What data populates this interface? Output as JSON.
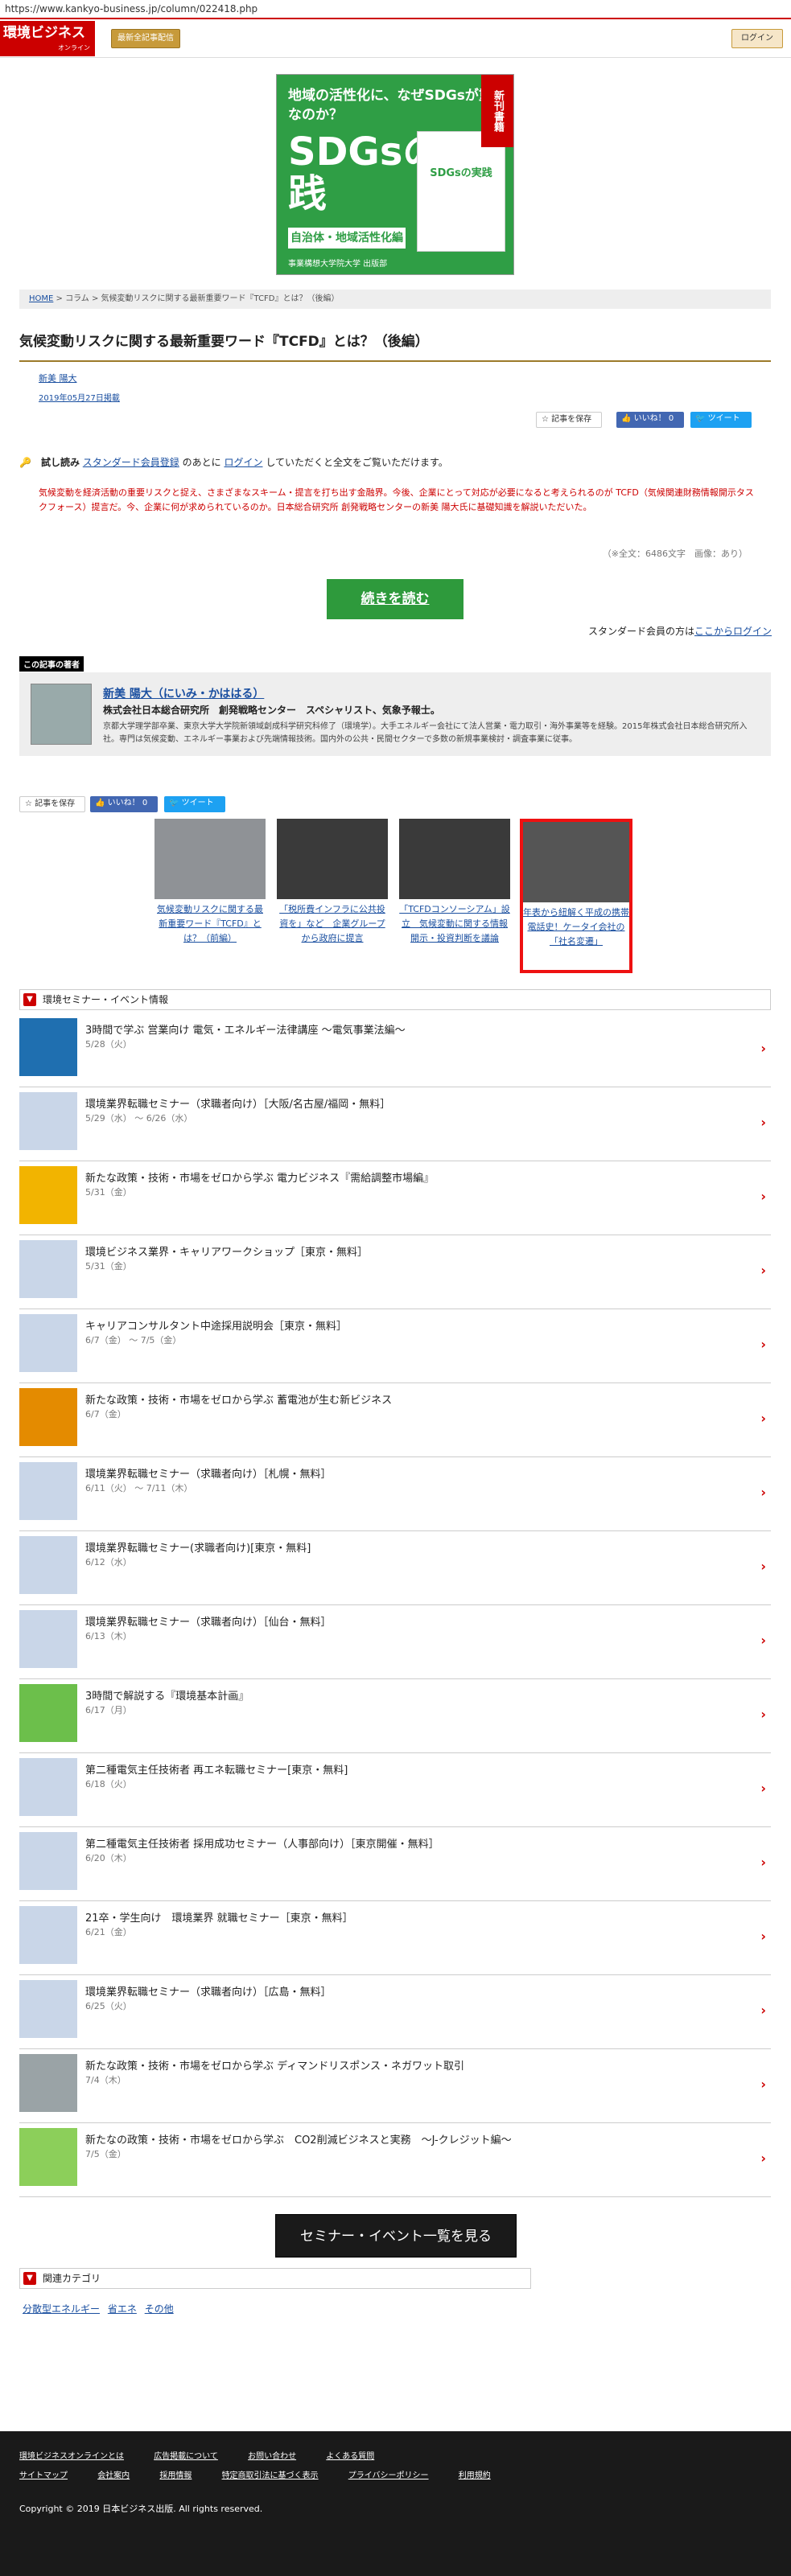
{
  "url": "https://www.kankyo-business.jp/column/022418.php",
  "header": {
    "logo_text": "環境ビジネス",
    "logo_sub": "オンライン",
    "news_button": "最新全記事配信",
    "login_button": "ログイン"
  },
  "banner": {
    "headline": "地域の活性化に、なぜSDGsが重要なのか？",
    "big_text": "SDGsの実践",
    "subtitle": "自治体・地域活性化編",
    "publisher": "事業構想大学院大学 出版部",
    "book_title": "SDGsの実践",
    "ribbon": "新刊書籍"
  },
  "breadcrumb": {
    "home": "HOME",
    "sep": " > ",
    "column": "コラム",
    "current": "気候変動リスクに関する最新重要ワード『TCFD』とは？（後編）"
  },
  "article": {
    "title": "気候変動リスクに関する最新重要ワード『TCFD』とは？（後編）",
    "author": "新美 陽大",
    "date": "2019年05月27日掲載",
    "save_label": "記事を保存",
    "like_label": "いいね！ 0",
    "tweet_label": "ツイート",
    "trial_label": "試し読み",
    "trial_link": "スタンダード会員登録",
    "trial_mid": "のあとに",
    "trial_login": "ログイン",
    "trial_tail": "していただくと全文をご覧いただけます。",
    "summary": "気候変動を経済活動の重要リスクと捉え、さまざまなスキーム・提言を打ち出す金融界。今後、企業にとって対応が必要になると考えられるのが TCFD（気候関連財務情報開示タスクフォース）提言だ。今、企業に何が求められているのか。日本総合研究所 創発戦略センターの新美 陽大氏に基礎知識を解説いただいた。",
    "count": "（※全文：6486文字　画像：あり）",
    "read_more": "続きを読む",
    "login_prefix": "スタンダード会員の方は",
    "login_link": "ここからログイン"
  },
  "author_box": {
    "section_label": "この記事の著者",
    "name": "新美 陽大（にいみ・かははる）",
    "org": "株式会社日本総合研究所　創発戦略センター　スペシャリスト、気象予報士。",
    "bio": "京都大学理学部卒業、東京大学大学院新領域創成科学研究科修了（環境学）。大手エネルギー会社にて法人営業・電力取引・海外事業等を経験。2015年株式会社日本総合研究所入社。専門は気候変動、エネルギー事業および先端情報技術。国内外の公共・民間セクターで多数の新規事業検討・調査事業に従事。"
  },
  "related": [
    {
      "caption": "気候変動リスクに関する最新重要ワード『TCFD』とは？（前編）"
    },
    {
      "caption": "「税所費インフラに公共投資を」など　企業グループから政府に提言"
    },
    {
      "caption": "「TCFDコンソーシアム」設立　気候変動に関する情報開示・投資判断を議論"
    },
    {
      "caption": "年表から紐解く平成の携帯電話史！ケータイ会社の「社名変遷」"
    }
  ],
  "events_section": {
    "title": "環境セミナー・イベント情報",
    "items": [
      {
        "title": "3時間で学ぶ 営業向け 電気・エネルギー法律講座 ～電気事業法編～",
        "date": "5/28（火）"
      },
      {
        "title": "環境業界転職セミナー（求職者向け）［大阪/名古屋/福岡・無料］",
        "date": "5/29（水） ～ 6/26（水）"
      },
      {
        "title": "新たな政策・技術・市場をゼロから学ぶ 電力ビジネス『需給調整市場編』",
        "date": "5/31（金）"
      },
      {
        "title": "環境ビジネス業界・キャリアワークショップ［東京・無料］",
        "date": "5/31（金）"
      },
      {
        "title": "キャリアコンサルタント中途採用説明会［東京・無料］",
        "date": "6/7（金） ～ 7/5（金）"
      },
      {
        "title": "新たな政策・技術・市場をゼロから学ぶ 蓄電池が生む新ビジネス",
        "date": "6/7（金）"
      },
      {
        "title": "環境業界転職セミナー（求職者向け）［札幌・無料］",
        "date": "6/11（火） ～ 7/11（木）"
      },
      {
        "title": "環境業界転職セミナー(求職者向け)[東京・無料]",
        "date": "6/12（水）"
      },
      {
        "title": "環境業界転職セミナー（求職者向け）［仙台・無料］",
        "date": "6/13（木）"
      },
      {
        "title": "3時間で解説する『環境基本計画』",
        "date": "6/17（月）"
      },
      {
        "title": "第二種電気主任技術者 再エネ転職セミナー[東京・無料]",
        "date": "6/18（火）"
      },
      {
        "title": "第二種電気主任技術者 採用成功セミナー（人事部向け）［東京開催・無料］",
        "date": "6/20（木）"
      },
      {
        "title": "21卒・学生向け　環境業界 就職セミナー［東京・無料］",
        "date": "6/21（金）"
      },
      {
        "title": "環境業界転職セミナー（求職者向け）［広島・無料］",
        "date": "6/25（火）"
      },
      {
        "title": "新たな政策・技術・市場をゼロから学ぶ ディマンドリスポンス・ネガワット取引",
        "date": "7/4（木）"
      },
      {
        "title": "新たなの政策・技術・市場をゼロから学ぶ　CO2削減ビジネスと実務　～J-クレジット編～",
        "date": "7/5（金）"
      }
    ],
    "all_button": "セミナー・イベント一覧を見る"
  },
  "categories_section": {
    "title": "関連カテゴリ",
    "items": [
      "分散型エネルギー",
      "省エネ",
      "その他"
    ]
  },
  "footer": {
    "row1": [
      "環境ビジネスオンラインとは",
      "広告掲載について",
      "お問い合わせ",
      "よくある質問"
    ],
    "row2": [
      "サイトマップ",
      "会社案内",
      "採用情報",
      "特定商取引法に基づく表示",
      "プライバシーポリシー",
      "利用規約"
    ],
    "copyright": "Copyright © 2019 日本ビジネス出版. All rights reserved."
  }
}
